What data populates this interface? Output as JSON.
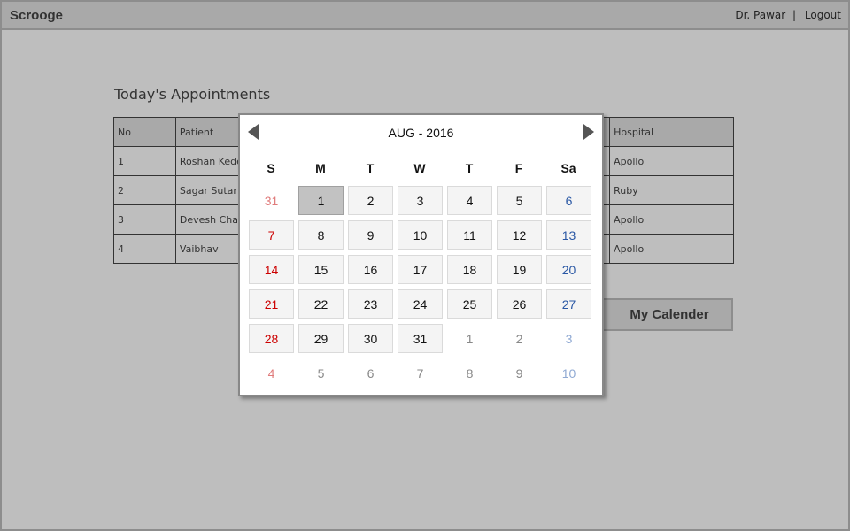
{
  "app": {
    "title": "Scrooge"
  },
  "header": {
    "user": "Dr. Pawar",
    "separator": "|",
    "logout": "Logout"
  },
  "appointments": {
    "title": "Today's Appointments",
    "columns": {
      "no": "No",
      "patient": "Patient",
      "hospital": "Hospital"
    },
    "rows": [
      {
        "no": "1",
        "patient": "Roshan Kede",
        "hospital": "Apollo"
      },
      {
        "no": "2",
        "patient": "Sagar Sutar",
        "hospital": "Ruby"
      },
      {
        "no": "3",
        "patient": "Devesh Cha",
        "hospital": "Apollo"
      },
      {
        "no": "4",
        "patient": "Vaibhav",
        "hospital": "Apollo"
      }
    ]
  },
  "calendar_button": {
    "label": "My Calender"
  },
  "datepicker": {
    "month_label": "AUG - 2016",
    "weekdays": [
      "S",
      "M",
      "T",
      "W",
      "T",
      "F",
      "Sa"
    ],
    "selected": "1",
    "weeks": [
      [
        {
          "d": "31",
          "in": false
        },
        {
          "d": "1",
          "in": true
        },
        {
          "d": "2",
          "in": true
        },
        {
          "d": "3",
          "in": true
        },
        {
          "d": "4",
          "in": true
        },
        {
          "d": "5",
          "in": true
        },
        {
          "d": "6",
          "in": true
        }
      ],
      [
        {
          "d": "7",
          "in": true
        },
        {
          "d": "8",
          "in": true
        },
        {
          "d": "9",
          "in": true
        },
        {
          "d": "10",
          "in": true
        },
        {
          "d": "11",
          "in": true
        },
        {
          "d": "12",
          "in": true
        },
        {
          "d": "13",
          "in": true
        }
      ],
      [
        {
          "d": "14",
          "in": true
        },
        {
          "d": "15",
          "in": true
        },
        {
          "d": "16",
          "in": true
        },
        {
          "d": "17",
          "in": true
        },
        {
          "d": "18",
          "in": true
        },
        {
          "d": "19",
          "in": true
        },
        {
          "d": "20",
          "in": true
        }
      ],
      [
        {
          "d": "21",
          "in": true
        },
        {
          "d": "22",
          "in": true
        },
        {
          "d": "23",
          "in": true
        },
        {
          "d": "24",
          "in": true
        },
        {
          "d": "25",
          "in": true
        },
        {
          "d": "26",
          "in": true
        },
        {
          "d": "27",
          "in": true
        }
      ],
      [
        {
          "d": "28",
          "in": true
        },
        {
          "d": "29",
          "in": true
        },
        {
          "d": "30",
          "in": true
        },
        {
          "d": "31",
          "in": true
        },
        {
          "d": "1",
          "in": false
        },
        {
          "d": "2",
          "in": false
        },
        {
          "d": "3",
          "in": false
        }
      ],
      [
        {
          "d": "4",
          "in": false
        },
        {
          "d": "5",
          "in": false
        },
        {
          "d": "6",
          "in": false
        },
        {
          "d": "7",
          "in": false
        },
        {
          "d": "8",
          "in": false
        },
        {
          "d": "9",
          "in": false
        },
        {
          "d": "10",
          "in": false
        }
      ]
    ]
  },
  "colors": {
    "sunday": "#cc0000",
    "saturday": "#2957a4",
    "selected": "#c2c2c2",
    "background": "#bebebe"
  }
}
